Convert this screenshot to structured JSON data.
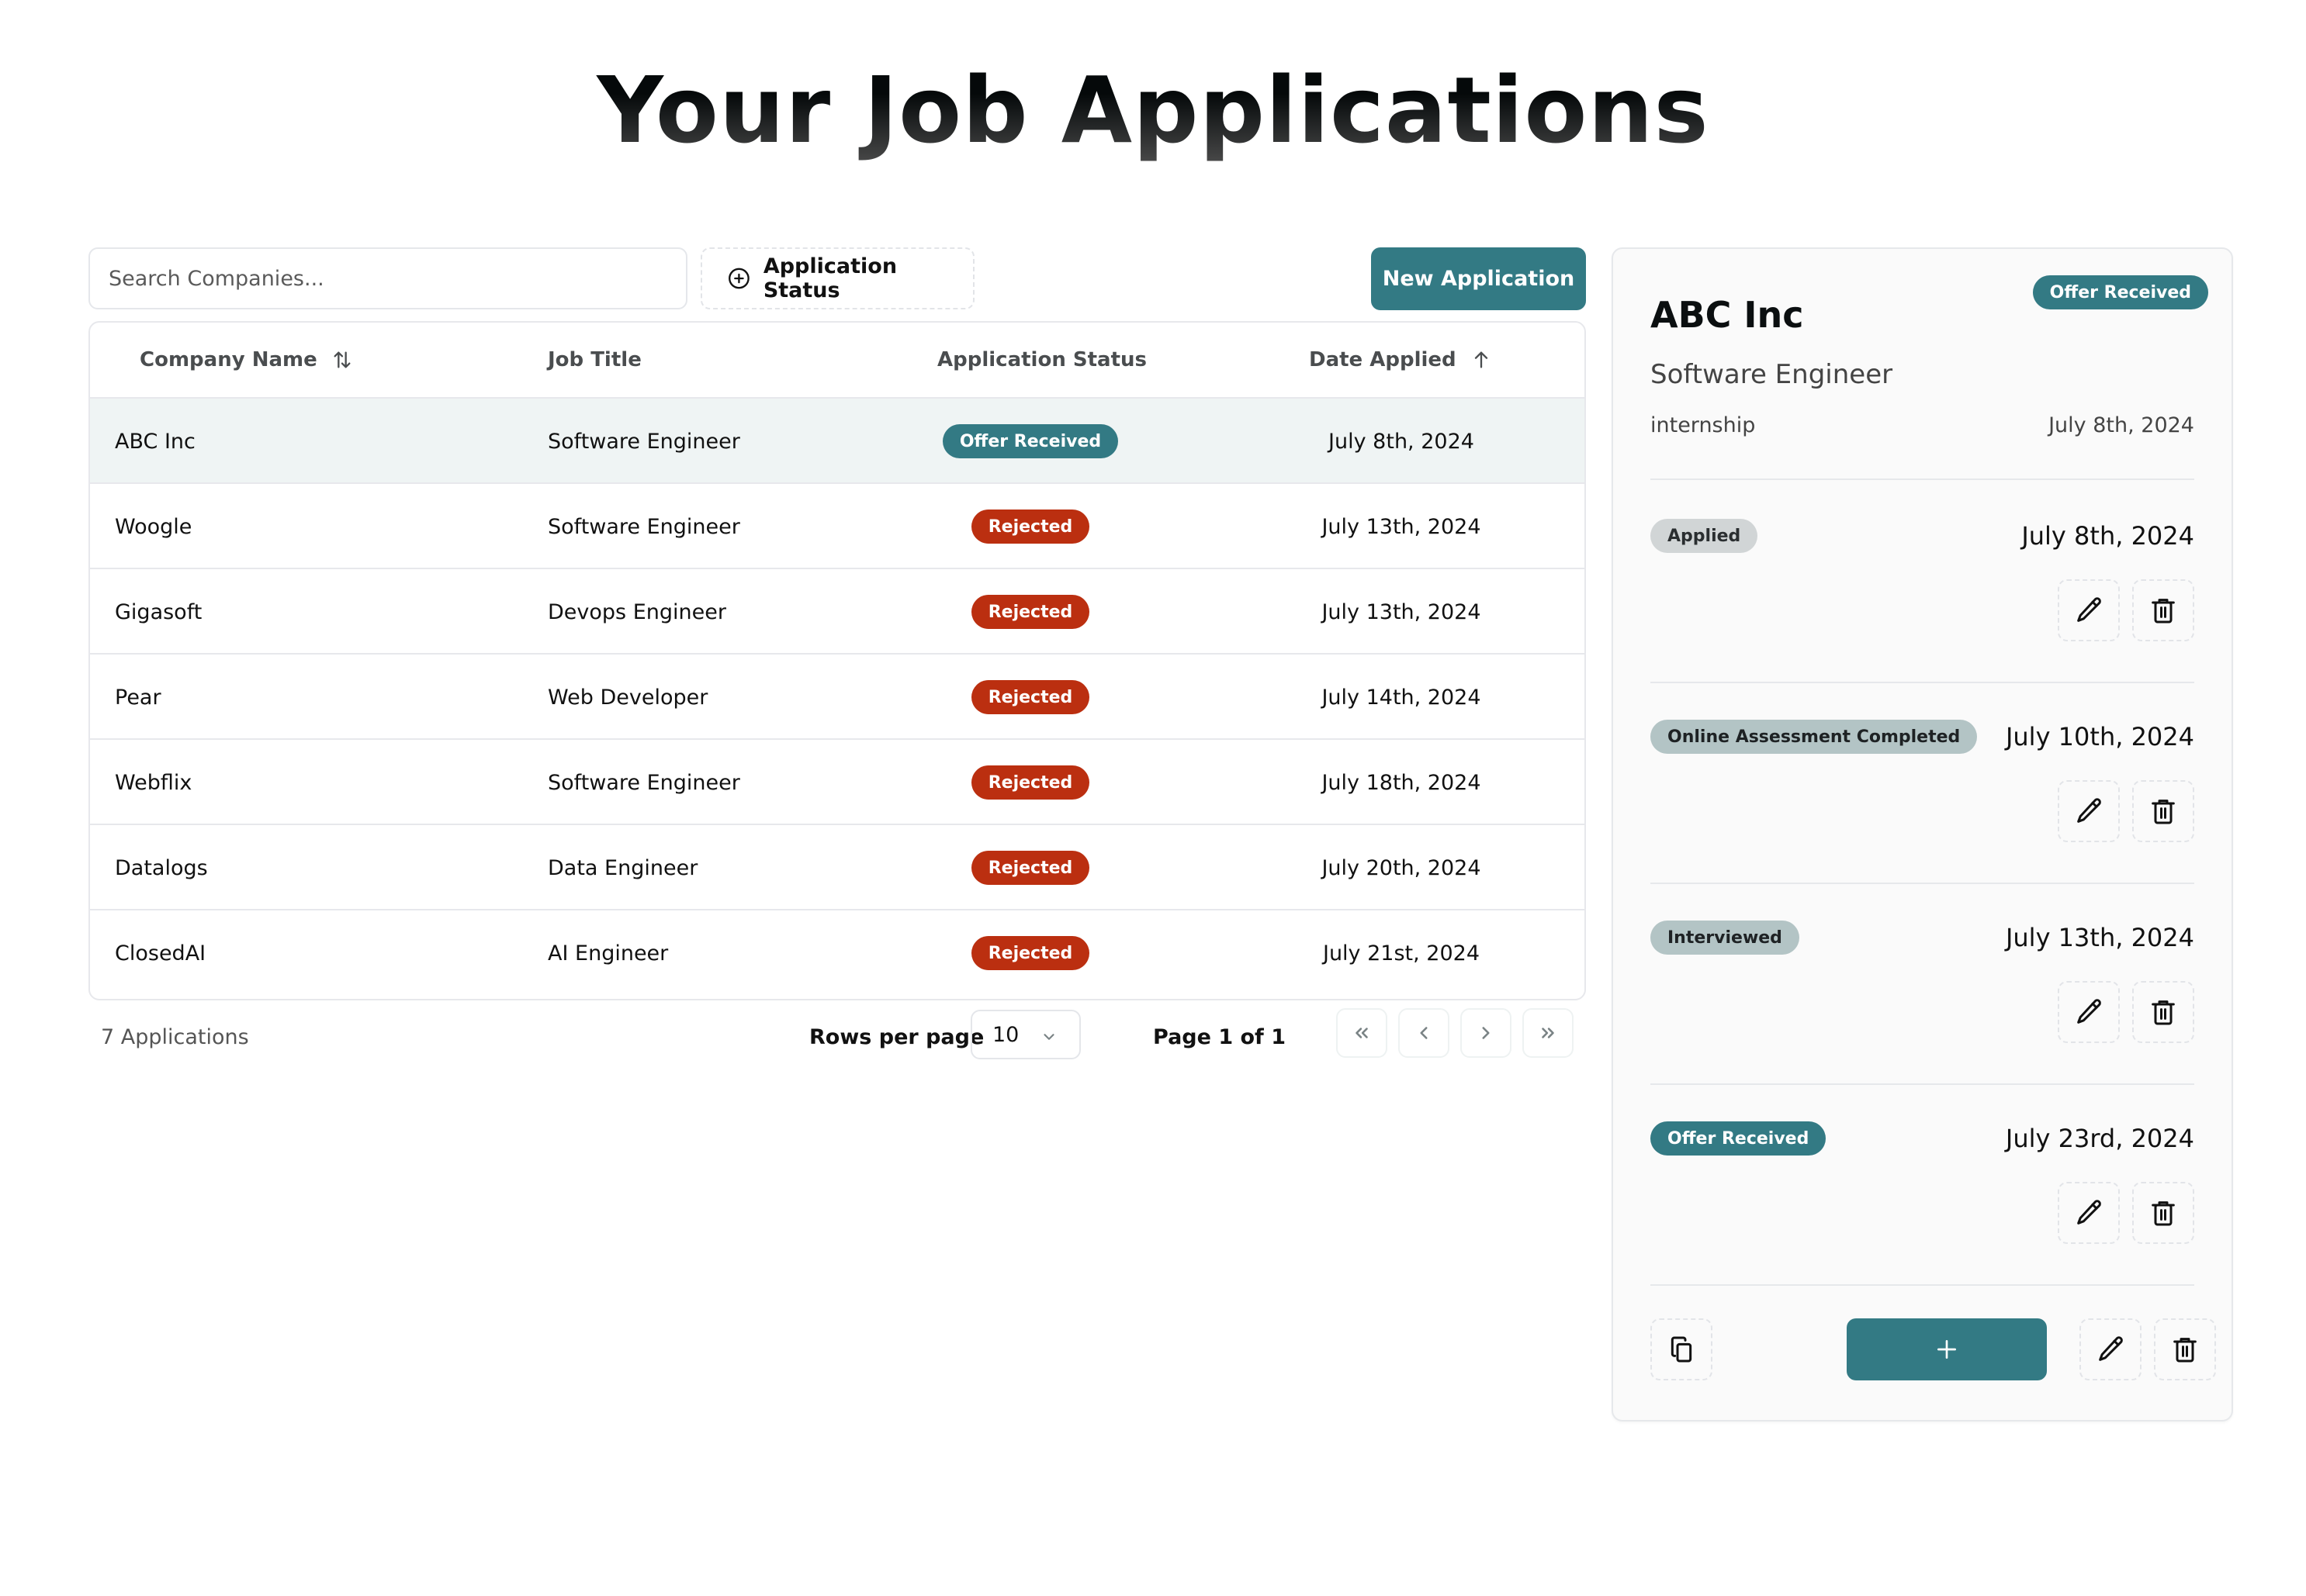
{
  "page": {
    "title": "Your Job Applications"
  },
  "toolbar": {
    "search_placeholder": "Search Companies...",
    "search_value": "",
    "status_filter_label": "Application Status",
    "new_application_label": "New Application"
  },
  "table": {
    "columns": [
      {
        "label": "Company Name",
        "sort_icon": "sort-both-icon"
      },
      {
        "label": "Job Title"
      },
      {
        "label": "Application Status"
      },
      {
        "label": "Date Applied",
        "sort_icon": "sort-ascending-icon"
      }
    ],
    "rows": [
      {
        "company": "ABC Inc",
        "job_title": "Software Engineer",
        "status": "Offer Received",
        "status_kind": "offer",
        "date": "July 8th, 2024",
        "selected": true
      },
      {
        "company": "Woogle",
        "job_title": "Software Engineer",
        "status": "Rejected",
        "status_kind": "rejected",
        "date": "July 13th, 2024"
      },
      {
        "company": "Gigasoft",
        "job_title": "Devops Engineer",
        "status": "Rejected",
        "status_kind": "rejected",
        "date": "July 13th, 2024"
      },
      {
        "company": "Pear",
        "job_title": "Web Developer",
        "status": "Rejected",
        "status_kind": "rejected",
        "date": "July 14th, 2024"
      },
      {
        "company": "Webflix",
        "job_title": "Software Engineer",
        "status": "Rejected",
        "status_kind": "rejected",
        "date": "July 18th, 2024"
      },
      {
        "company": "Datalogs",
        "job_title": "Data Engineer",
        "status": "Rejected",
        "status_kind": "rejected",
        "date": "July 20th, 2024"
      },
      {
        "company": "ClosedAI",
        "job_title": "AI Engineer",
        "status": "Rejected",
        "status_kind": "rejected",
        "date": "July 21st, 2024"
      }
    ]
  },
  "footer": {
    "count_label": "7 Applications",
    "rows_per_page_label": "Rows per page",
    "rows_per_page_value": "10",
    "page_info": "Page 1 of 1",
    "nav": [
      "first-page",
      "previous-page",
      "next-page",
      "last-page"
    ]
  },
  "detail": {
    "company": "ABC Inc",
    "status": "Offer Received",
    "job_title": "Software Engineer",
    "job_type": "internship",
    "date_applied": "July 8th, 2024",
    "timeline": [
      {
        "status": "Applied",
        "kind": "applied",
        "date": "July 8th, 2024"
      },
      {
        "status": "Online Assessment Completed",
        "kind": "assess",
        "date": "July 10th, 2024"
      },
      {
        "status": "Interviewed",
        "kind": "assess",
        "date": "July 13th, 2024"
      },
      {
        "status": "Offer Received",
        "kind": "offer",
        "date": "July 23rd, 2024"
      }
    ]
  },
  "colors": {
    "accent": "#337a84",
    "rejected": "#bb2f10",
    "applied_badge": "#d1d5d6",
    "progress_badge": "#b3c4c5",
    "selected_row": "#eff4f4",
    "panel_bg": "#fafafa"
  }
}
